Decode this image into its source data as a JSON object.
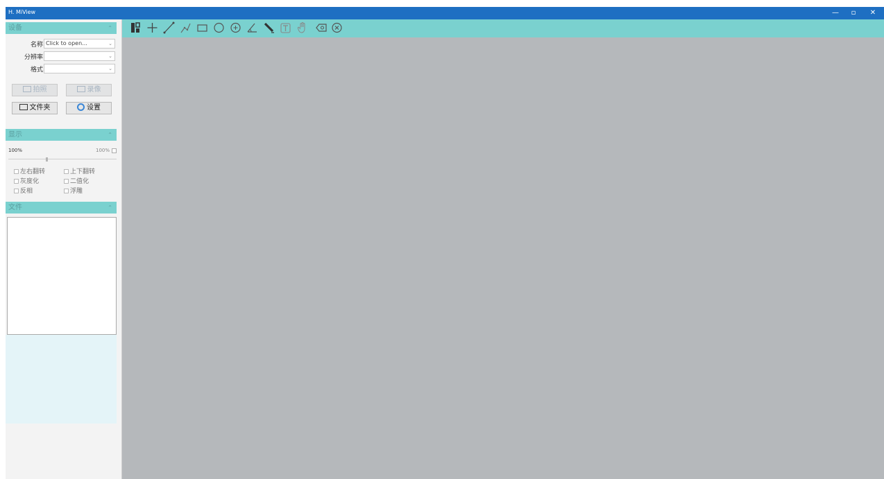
{
  "titlebar": {
    "title": "H. MiView",
    "minimize": "—",
    "maximize": "▫",
    "close": "✕"
  },
  "device": {
    "header": "设备",
    "collapse_icon": "chevron-up-icon",
    "name_label": "名称",
    "name_value": "Click to open...",
    "resolution_label": "分辨率",
    "resolution_value": "",
    "format_label": "格式",
    "format_value": "",
    "capture_label": "拍照",
    "record_label": "录像",
    "folder_label": "文件夹",
    "settings_label": "设置"
  },
  "display": {
    "header": "显示",
    "zoom_left": "100%",
    "zoom_right": "100%",
    "zoom_level": 0.35,
    "options": [
      "左右翻转",
      "上下翻转",
      "灰度化",
      "二值化",
      "反相",
      "浮雕"
    ]
  },
  "files": {
    "header": "文件"
  },
  "toolbar": {
    "tools": [
      "compare-icon",
      "crosshair-icon",
      "line-icon",
      "polyline-icon",
      "rectangle-icon",
      "circle-icon",
      "circle-center-icon",
      "angle-icon",
      "pen-icon",
      "text-icon",
      "hand-icon",
      "eraser-icon",
      "clear-icon"
    ]
  },
  "colors": {
    "titlebar": "#1e6fc2",
    "accent": "#7ad1cf",
    "canvas": "#b5b8bb"
  }
}
